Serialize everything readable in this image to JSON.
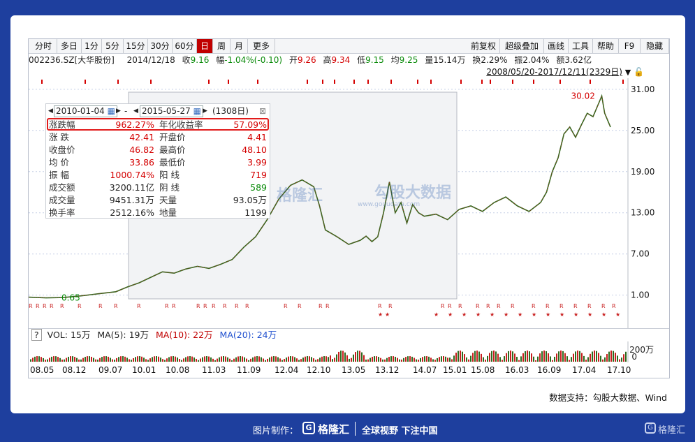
{
  "toolbar": {
    "left": [
      "分时",
      "多日",
      "1分",
      "5分",
      "15分",
      "30分",
      "60分",
      "日",
      "周",
      "月",
      "更多"
    ],
    "active": "日",
    "right": [
      "前复权",
      "超级叠加",
      "画线",
      "工具",
      "帮助",
      "F9",
      "隐藏"
    ]
  },
  "quote": {
    "code": "002236.SZ[大华股份]",
    "date": "2014/12/18",
    "close_label": "收",
    "close": "9.16",
    "change_label": "幅",
    "change": "-1.04%(-0.10)",
    "open_label": "开",
    "open": "9.26",
    "high_label": "高",
    "high": "9.34",
    "low_label": "低",
    "low": "9.15",
    "avg_label": "均",
    "avg": "9.25",
    "vol_label": "量",
    "vol": "15.14万",
    "turn_label": "换",
    "turn": "2.29%",
    "amp_label": "振",
    "amp": "2.04%",
    "amt_label": "额",
    "amt": "3.62亿"
  },
  "range": "2008/05/20-2017/12/11(2329日)",
  "popup": {
    "start": "2010-01-04",
    "end": "2015-05-27",
    "days": "(1308日)",
    "rows": [
      {
        "l": "涨跌幅",
        "v": "962.27%",
        "l2": "年化收益率",
        "v2": "57.09%",
        "c": "red",
        "c2": "red"
      },
      {
        "l": "涨  跌",
        "v": "42.41",
        "l2": "开盘价",
        "v2": "4.41",
        "c": "red",
        "c2": "red"
      },
      {
        "l": "收盘价",
        "v": "46.82",
        "l2": "最高价",
        "v2": "48.10",
        "c": "red",
        "c2": "red"
      },
      {
        "l": "均  价",
        "v": "33.86",
        "l2": "最低价",
        "v2": "3.99",
        "c": "red",
        "c2": "red"
      },
      {
        "l": "振  幅",
        "v": "1000.74%",
        "l2": "阳  线",
        "v2": "719",
        "c": "red",
        "c2": "red"
      },
      {
        "l": "成交额",
        "v": "3200.11亿",
        "l2": "阴  线",
        "v2": "589",
        "c": "black",
        "c2": "green"
      },
      {
        "l": "成交量",
        "v": "9451.31万",
        "l2": "天量",
        "v2": "93.05万",
        "c": "black",
        "c2": "black"
      },
      {
        "l": "换手率",
        "v": "2512.16%",
        "l2": "地量",
        "v2": "1199",
        "c": "black",
        "c2": "black"
      }
    ]
  },
  "chart_data": {
    "type": "line",
    "y_ticks": [
      "31.00",
      "25.00",
      "19.00",
      "13.00",
      "7.00",
      "1.00"
    ],
    "ylim": [
      -3,
      32
    ],
    "x_ticks": [
      "08.05",
      "08.12",
      "09.07",
      "10.01",
      "10.08",
      "11.03",
      "11.09",
      "12.04",
      "12.10",
      "13.05",
      "13.12",
      "14.07",
      "15.01",
      "15.08",
      "16.03",
      "16.09",
      "17.04",
      "17.10"
    ],
    "annotations": {
      "max": "30.02",
      "min": "0.65"
    },
    "series": [
      {
        "x": [
          0,
          0.03,
          0.06,
          0.09,
          0.12,
          0.15,
          0.17,
          0.19,
          0.21,
          0.23,
          0.25,
          0.27,
          0.29,
          0.31,
          0.33,
          0.35,
          0.37,
          0.39,
          0.41,
          0.43,
          0.45,
          0.47,
          0.49,
          0.5,
          0.51,
          0.52,
          0.53,
          0.55,
          0.57,
          0.58,
          0.59,
          0.6,
          0.61,
          0.62,
          0.63,
          0.64,
          0.65,
          0.66,
          0.67,
          0.68,
          0.7,
          0.72,
          0.74,
          0.76,
          0.78,
          0.8,
          0.82,
          0.84,
          0.86,
          0.88,
          0.89,
          0.9,
          0.91,
          0.92,
          0.93,
          0.94,
          0.95,
          0.96,
          0.97,
          0.98,
          0.985,
          0.99,
          1
        ],
        "values": [
          0.7,
          0.6,
          0.65,
          0.9,
          1.2,
          1.5,
          2.2,
          2.8,
          3.6,
          4.4,
          4.2,
          4.8,
          5.2,
          4.9,
          5.5,
          6.2,
          8.0,
          9.5,
          12.0,
          15.0,
          17.0,
          17.8,
          16.8,
          14.0,
          10.5,
          10.0,
          9.5,
          8.4,
          9.0,
          9.6,
          8.8,
          9.5,
          13.0,
          17.5,
          13.0,
          14.5,
          11.5,
          14.2,
          13.0,
          12.5,
          12.8,
          12.0,
          13.5,
          14.0,
          13.2,
          14.5,
          15.3,
          14.0,
          13.2,
          14.5,
          16.0,
          19.0,
          21.0,
          24.5,
          25.5,
          24.0,
          25.8,
          27.5,
          27.0,
          29.0,
          30.02,
          27.5,
          25.5
        ]
      }
    ]
  },
  "vol": {
    "label": "VOL: 15万",
    "ma5": "MA(5): 19万",
    "ma10": "MA(10): 22万",
    "ma20": "MA(20): 24万",
    "max": "200万",
    "zero": "0"
  },
  "credit": "数据支持：勾股大数据、Wind",
  "watermark": {
    "left": "格隆汇",
    "right": "勾股大数据",
    "url": "www.gogudata.com"
  },
  "footer": {
    "made_by": "图片制作：",
    "brand": "格隆汇",
    "slogan": "全球视野 下注中国",
    "corner": "格隆汇"
  }
}
